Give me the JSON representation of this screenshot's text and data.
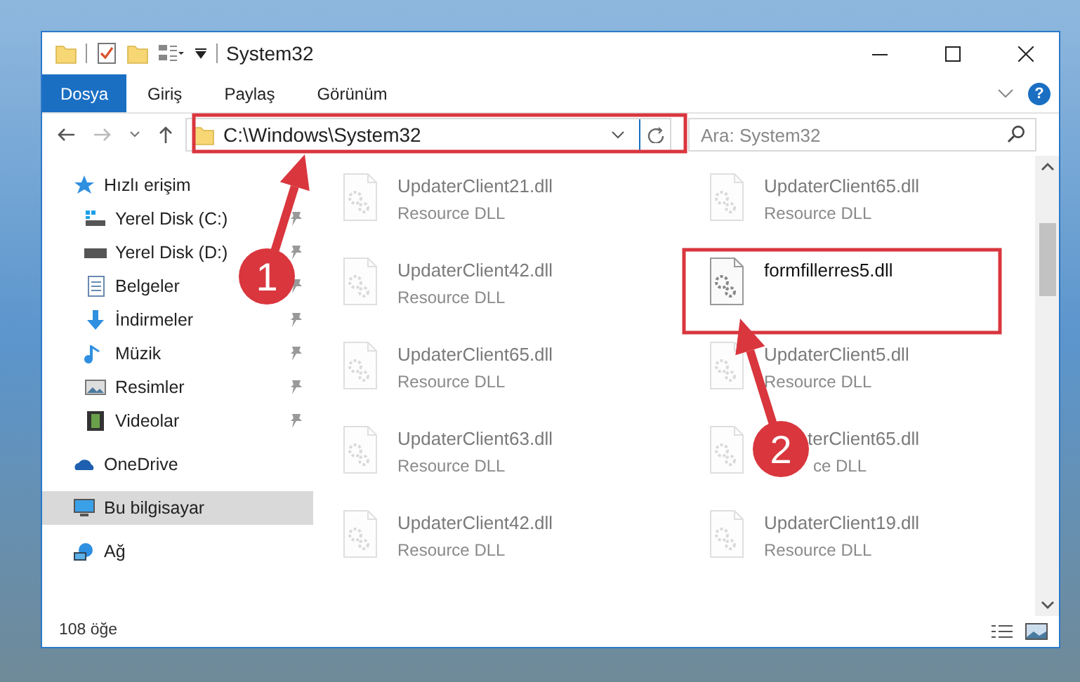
{
  "window": {
    "title": "System32"
  },
  "ribbon_tabs": [
    {
      "label": "Dosya",
      "kind": "file"
    },
    {
      "label": "Giriş",
      "kind": "tab"
    },
    {
      "label": "Paylaş",
      "kind": "tab"
    },
    {
      "label": "Görünüm",
      "kind": "tab"
    }
  ],
  "address_bar": {
    "path": "C:\\Windows\\System32"
  },
  "search": {
    "placeholder": "Ara: System32"
  },
  "sidebar": {
    "items": [
      {
        "label": "Hızlı erişim",
        "kind": "star",
        "selected": false,
        "children": [
          {
            "label": "Yerel Disk (C:)",
            "kind": "drive_c",
            "pinned": true
          },
          {
            "label": "Yerel Disk (D:)",
            "kind": "drive",
            "pinned": true
          },
          {
            "label": "Belgeler",
            "kind": "document",
            "pinned": true
          },
          {
            "label": "İndirmeler",
            "kind": "download",
            "pinned": true
          },
          {
            "label": "Müzik",
            "kind": "music",
            "pinned": true
          },
          {
            "label": "Resimler",
            "kind": "pictures",
            "pinned": true
          },
          {
            "label": "Videolar",
            "kind": "video",
            "pinned": true
          }
        ]
      },
      {
        "label": "OneDrive",
        "kind": "cloud",
        "selected": false
      },
      {
        "label": "Bu bilgisayar",
        "kind": "computer",
        "selected": true
      },
      {
        "label": "Ağ",
        "kind": "network",
        "selected": false
      }
    ]
  },
  "files": [
    {
      "name": "UpdaterClient21.dll",
      "type": "Resource DLL",
      "blurred": true
    },
    {
      "name": "UpdaterClient65.dll",
      "type": "Resource DLL",
      "blurred": true
    },
    {
      "name": "UpdaterClient42.dll",
      "type": "Resource DLL",
      "blurred": true
    },
    {
      "name": "formfillerres5.dll",
      "blurred": false
    },
    {
      "name": "UpdaterClient65.dll",
      "type": "Resource DLL",
      "blurred": true
    },
    {
      "name": "UpdaterClient5.dll",
      "type": "Resource DLL",
      "blurred": true
    },
    {
      "name": "UpdaterClient63.dll",
      "type": "Resource DLL",
      "blurred": true
    },
    {
      "name": "terClient65.dll",
      "type": "ce DLL",
      "blurred": true,
      "clipped": true
    },
    {
      "name": "UpdaterClient42.dll",
      "type": "Resource DLL",
      "blurred": true
    },
    {
      "name": "UpdaterClient19.dll",
      "type": "Resource DLL",
      "blurred": true
    }
  ],
  "status_bar": {
    "count": "108 öğe"
  },
  "help_button": {
    "label": "?"
  },
  "annotations": [
    {
      "number": "1"
    },
    {
      "number": "2"
    }
  ]
}
